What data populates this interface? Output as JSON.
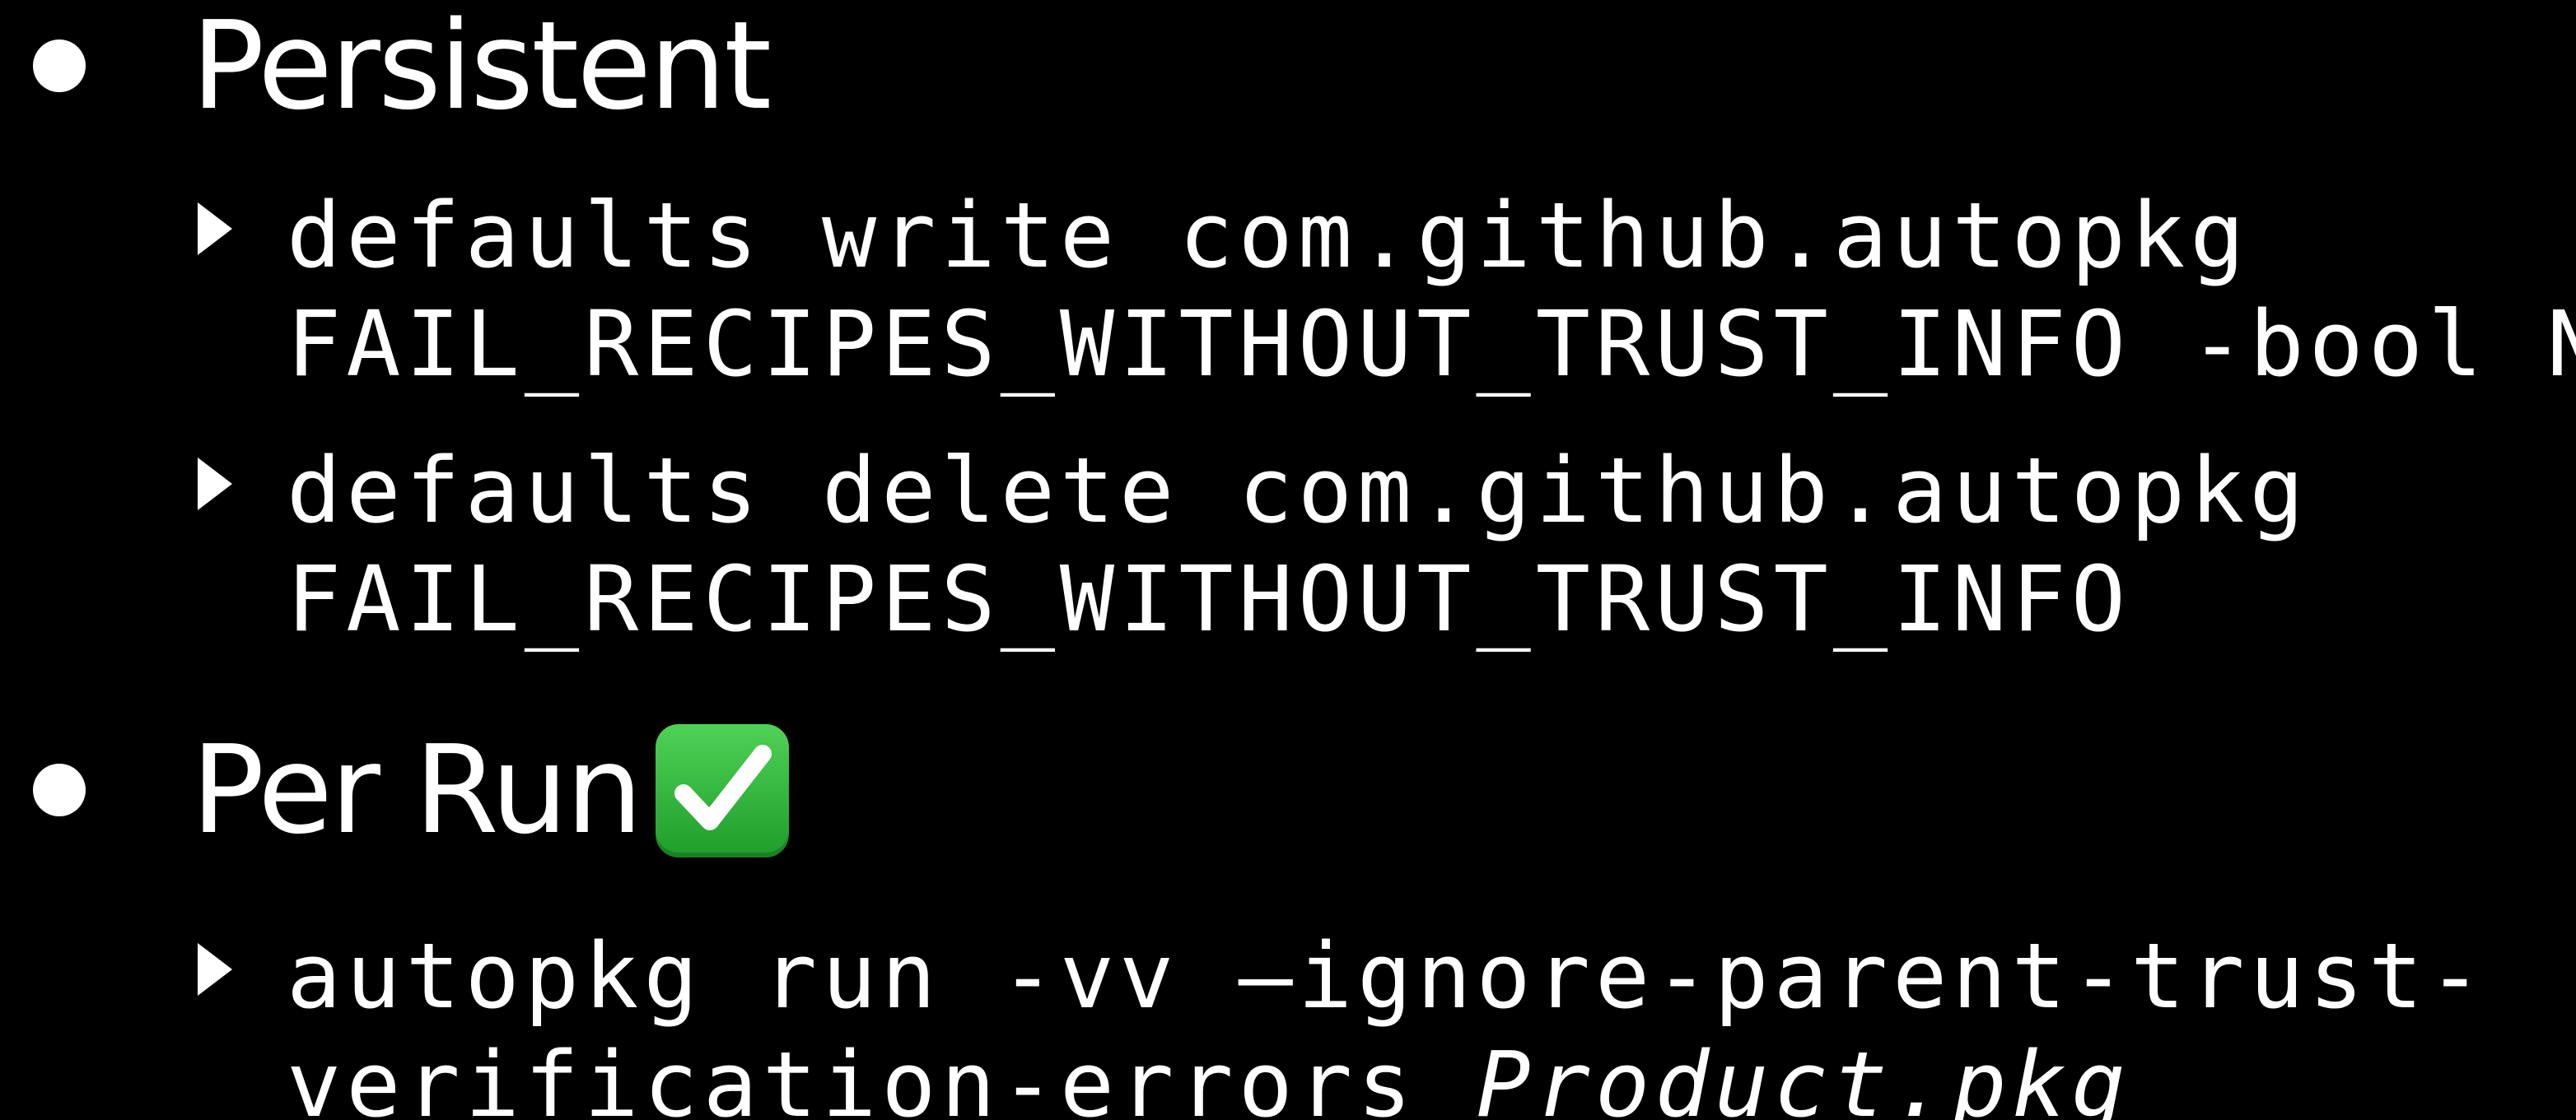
{
  "slide": {
    "background": "#000000",
    "text_color": "#ffffff",
    "sections": [
      {
        "heading": "Persistent",
        "items": [
          {
            "line1": "defaults write com.github.autopkg",
            "line2": "FAIL_RECIPES_WITHOUT_TRUST_INFO -bool NO"
          },
          {
            "line1": "defaults delete com.github.autopkg",
            "line2": "FAIL_RECIPES_WITHOUT_TRUST_INFO"
          }
        ]
      },
      {
        "heading": "Per Run",
        "heading_emoji": "check-mark-button-icon",
        "emoji_color": "#2fb53b",
        "items": [
          {
            "line1": "autopkg run -vv –ignore-parent-trust-",
            "line2_prefix": "verification-errors ",
            "line2_italic": "Product.pkg"
          }
        ]
      }
    ]
  }
}
